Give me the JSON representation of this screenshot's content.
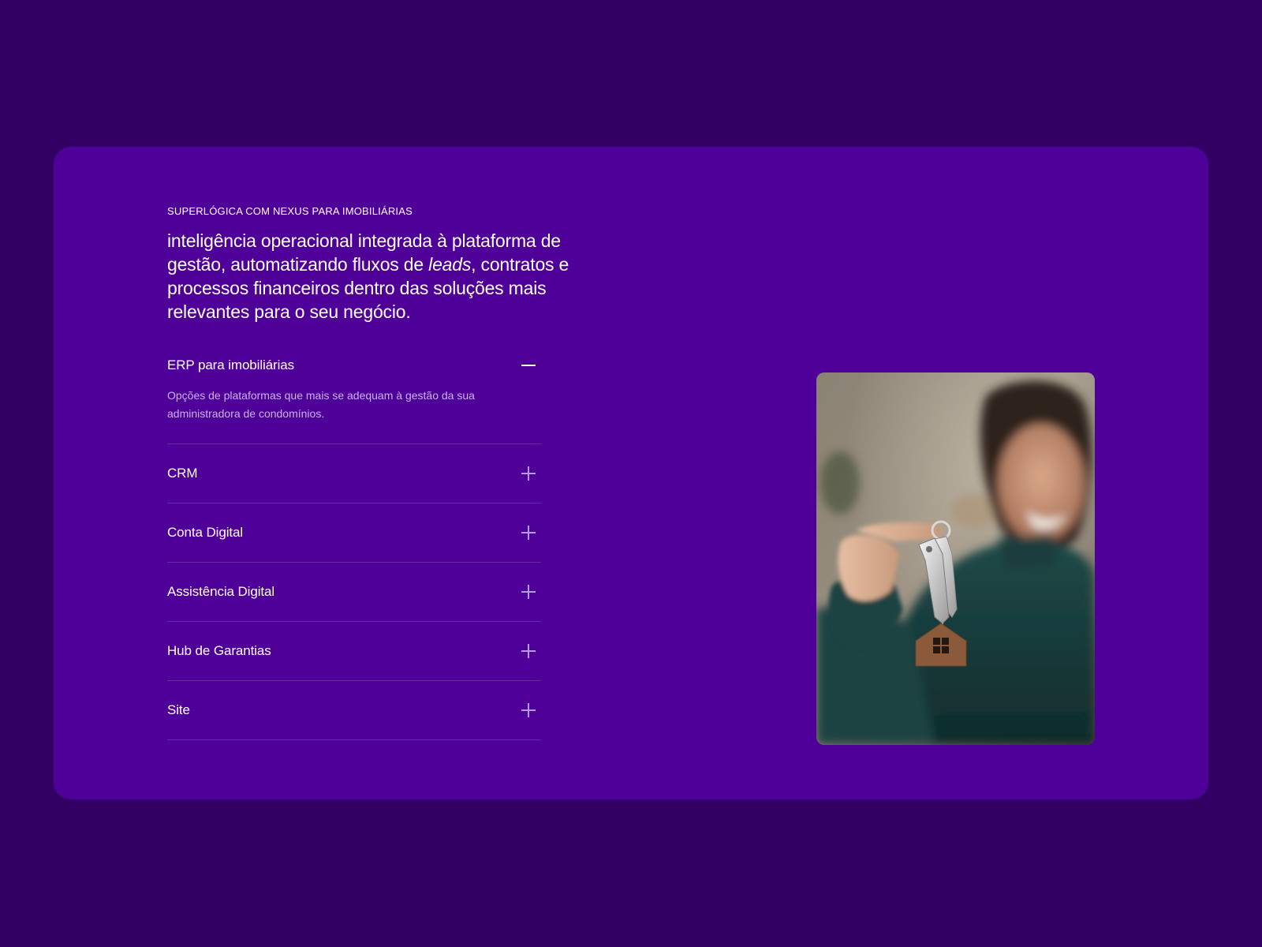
{
  "section": {
    "eyebrow": "SUPERLÓGICA COM NEXUS PARA IMOBILIÁRIAS",
    "headline_before": "inteligência operacional integrada à plataforma de gestão, automatizando fluxos de ",
    "headline_italic": "leads",
    "headline_after": ", contratos e processos financeiros dentro das soluções mais relevantes para o seu negócio."
  },
  "accordion": {
    "open_item": {
      "title": "ERP para imobiliárias",
      "description": "Opções de plataformas que mais se adequam à gestão da sua administradora de condomínios.",
      "icon": "minus-icon"
    },
    "items": [
      {
        "title": "CRM",
        "icon": "plus-icon"
      },
      {
        "title": "Conta Digital",
        "icon": "plus-icon"
      },
      {
        "title": "Assistência Digital",
        "icon": "plus-icon"
      },
      {
        "title": "Hub de Garantias",
        "icon": "plus-icon"
      },
      {
        "title": "Site",
        "icon": "plus-icon"
      }
    ]
  },
  "image": {
    "subject": "woman-holding-house-keys-photo"
  },
  "colors": {
    "page_background": "#310062",
    "card_background": "#4f0098",
    "text_primary": "#ffffff",
    "text_muted": "#c9b2ea",
    "icon_muted": "#b49be0"
  }
}
